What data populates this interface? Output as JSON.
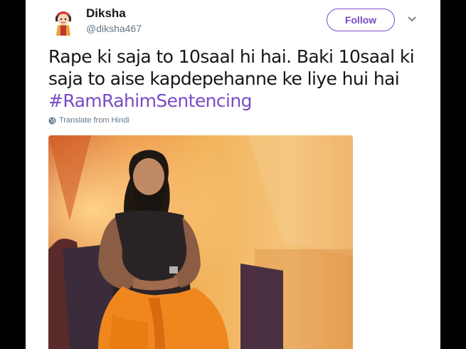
{
  "user": {
    "name": "Diksha",
    "handle": "@diksha467",
    "avatar_icon": "cartoon-girl-avatar"
  },
  "follow_label": "Follow",
  "menu_icon": "chevron-down-icon",
  "tweet": {
    "text_line1": "Rape ki saja to 10saal hi hai. Baki 10saal ki",
    "text_line2": "saja to aise kapdepehanne ke liye hui hai",
    "hashtag": "#RamRahimSentencing"
  },
  "translate_label": "Translate from Hindi",
  "translate_icon": "globe-icon",
  "photo_icon": "photo-man-seated-on-stage",
  "colors": {
    "accent": "#794bc4",
    "text": "#14171a",
    "secondary": "#657786"
  }
}
